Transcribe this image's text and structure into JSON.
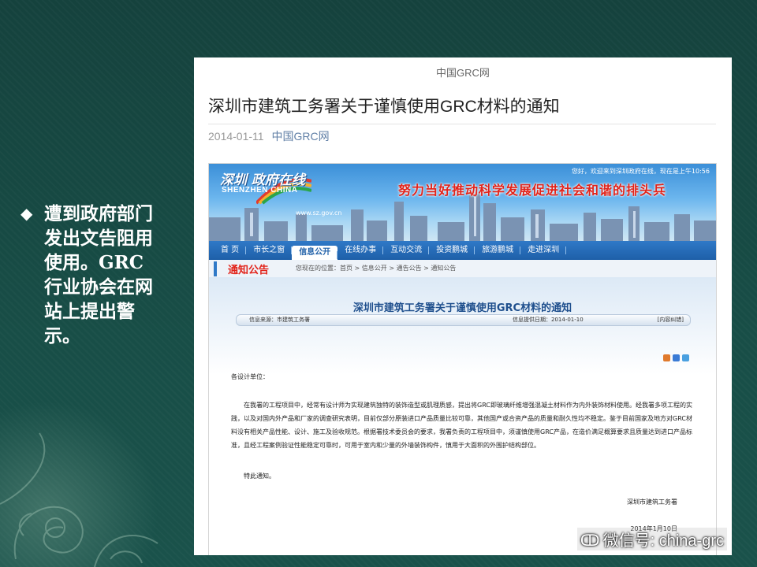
{
  "slide": {
    "bullet": "遭到政府部门发出文告阻用使用。GRC行业协会在网站上提出警示。"
  },
  "article": {
    "site_name": "中国GRC网",
    "title": "深圳市建筑工务署关于谨慎使用GRC材料的通知",
    "date": "2014-01-11",
    "source": "中国GRC网"
  },
  "gov_site": {
    "logo_cn": "深圳 政府在线",
    "logo_en": "SHENZHEN CHINA",
    "logo_url": "www.sz.gov.cn",
    "welcome": "您好，欢迎来到深圳政府在线，现在是上午10:56",
    "slogan": "努力当好推动科学发展促进社会和谐的排头兵",
    "nav": [
      "首 页",
      "市长之窗",
      "信息公开",
      "在线办事",
      "互动交流",
      "投资鹏城",
      "旅游鹏城",
      "走进深圳"
    ],
    "nav_active_index": 2,
    "section_label": "通知公告",
    "breadcrumb": "您现在的位置：首页 > 信息公开 > 通告公告 > 通知公告",
    "notice_title": "深圳市建筑工务署关于谨慎使用GRC材料的通知",
    "info_source": "信息来源：市建筑工务署",
    "info_date": "信息提供日期：2014-01-10",
    "content_correction": "[内容纠错]",
    "salutation": "各设计单位：",
    "body": "在我署的工程项目中，经常有设计师为实现建筑独特的装饰造型或肌理质感，提出将GRC即玻璃纤维增强混凝土材料作为内外装饰材料使用。经我署多项工程的实践，以及对国内外产品和厂家的调查研究表明，目前仅部分原装进口产品质量比较可靠，其他国产或合资产品的质量和耐久性均不稳定。鉴于目前国家及地方对GRC材料没有相关产品性能、设计、施工及验收规范。根据署技术委员会的要求，我署负责的工程项目中，须谨慎使用GRC产品，在造价满足概算要求且质量达到进口产品标准，且经工程案例验证性能稳定可靠时，可用于室内和少量的外墙装饰构件，慎用于大面积的外围护结构部位。",
    "closing": "特此通知。",
    "signature": "深圳市建筑工务署",
    "sign_date": "2014年1月10日"
  },
  "watermark": "微信号: china-grc",
  "colors": {
    "slide_bg": "#164a44",
    "nav_blue": "#1e5fa8",
    "slogan_red": "#e2231a",
    "notice_title_blue": "#1f4f8d"
  }
}
